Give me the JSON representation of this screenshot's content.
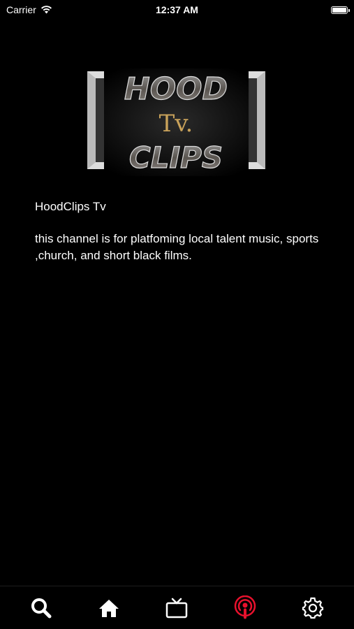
{
  "status_bar": {
    "carrier": "Carrier",
    "time": "12:37 AM"
  },
  "logo": {
    "line1": "HOOD",
    "line2": "Tv.",
    "line3": "CLIPS"
  },
  "channel": {
    "name": "HoodClips Tv",
    "description": "this channel is for platfoming local talent music, sports ,church, and short black films."
  },
  "tab_bar": {
    "items": [
      {
        "icon": "search-icon",
        "active": false
      },
      {
        "icon": "home-icon",
        "active": false
      },
      {
        "icon": "tv-icon",
        "active": false
      },
      {
        "icon": "podcast-icon",
        "active": true
      },
      {
        "icon": "gear-icon",
        "active": false
      }
    ],
    "active_color": "#e8112d",
    "inactive_color": "#ffffff"
  }
}
